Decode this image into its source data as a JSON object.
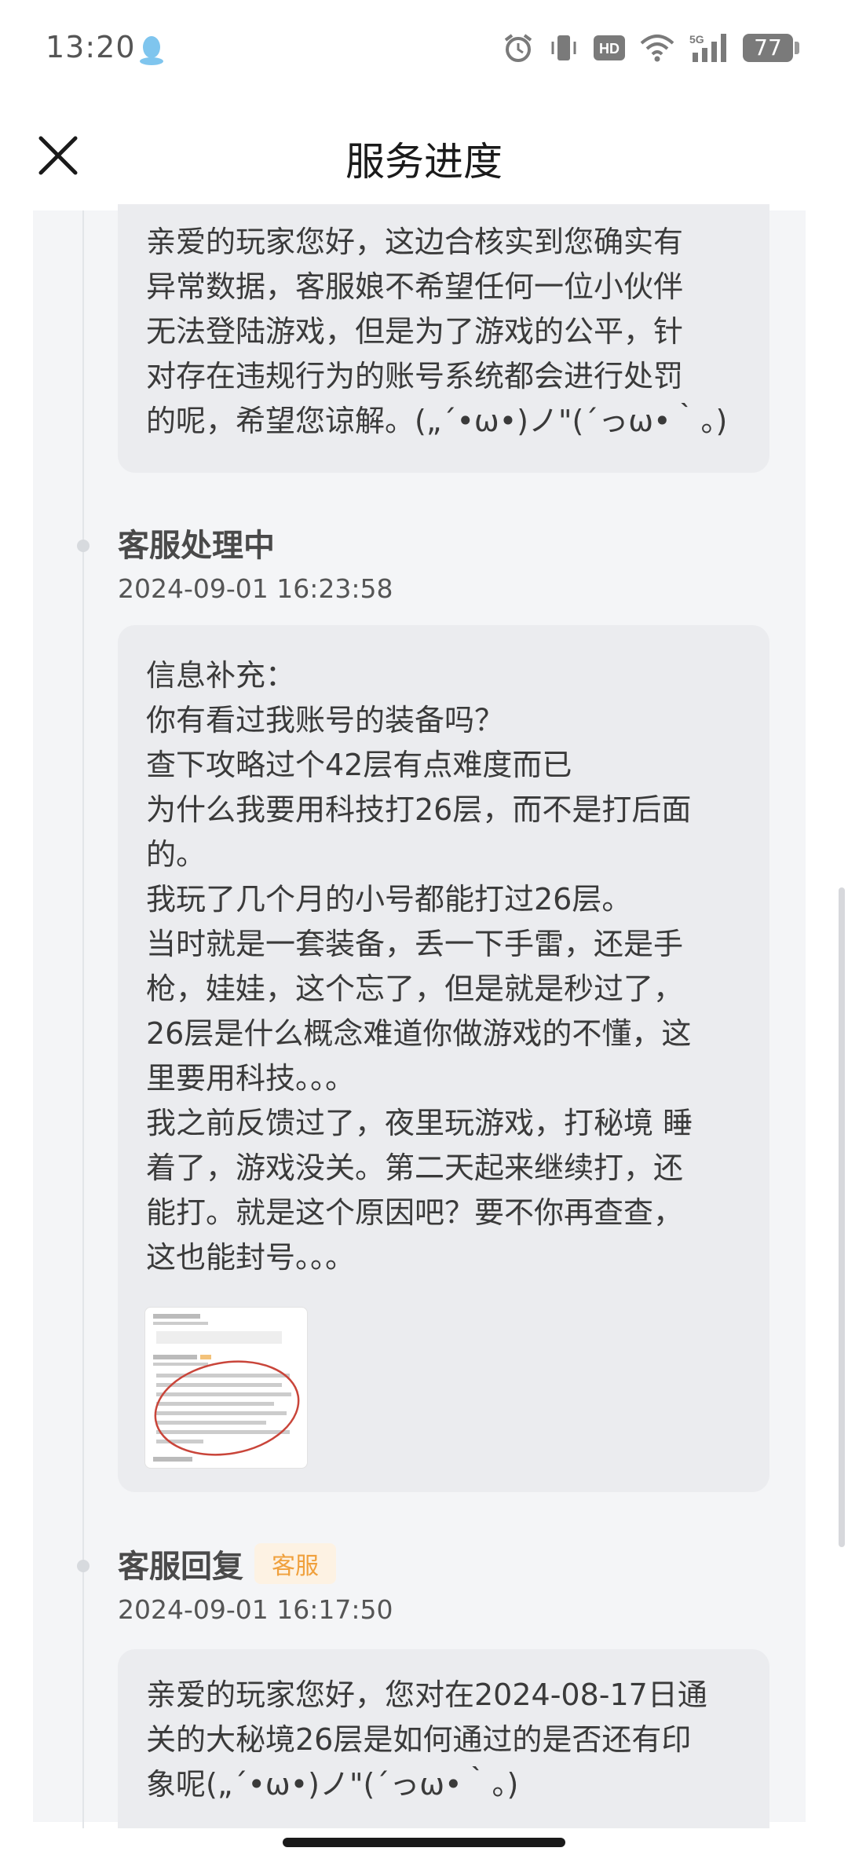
{
  "status_bar": {
    "time": "13:20",
    "icons": [
      "qq-icon",
      "alarm-icon",
      "vibrate-icon",
      "hd-icon",
      "wifi-icon",
      "5g-signal-icon"
    ],
    "battery": "77"
  },
  "header": {
    "title": "服务进度"
  },
  "entries": [
    {
      "message": "亲爱的玩家您好，这边合核实到您确实有\n异常数据，客服娘不希望任何一位小伙伴\n无法登陆游戏，但是为了游戏的公平，针\n对存在违规行为的账号系统都会进行处罚\n的呢，希望您谅解。(„´•ω•)ノ\"(´っω•｀。)"
    },
    {
      "title": "客服处理中",
      "time": "2024-09-01 16:23:58",
      "message": "信息补充：\n你有看过我账号的装备吗？\n查下攻略过个42层有点难度而已\n为什么我要用科技打26层，而不是打后面\n的。\n我玩了几个月的小号都能打过26层。\n当时就是一套装备，丢一下手雷，还是手\n枪，娃娃，这个忘了，但是就是秒过了，\n26层是什么概念难道你做游戏的不懂，这\n里要用科技。。。\n我之前反馈过了，夜里玩游戏，打秘境 睡\n着了，游戏没关。第二天起来继续打，还\n能打。就是这个原因吧？要不你再查查，\n这也能封号。。。"
    },
    {
      "title": "客服回复",
      "tag": "客服",
      "time": "2024-09-01 16:17:50",
      "message": "亲爱的玩家您好，您对在2024-08-17日通\n关的大秘境26层是如何通过的是否还有印\n象呢(„´•ω•)ノ\"(´っω•｀。)"
    }
  ],
  "colors": {
    "page_bg": "#f4f5f7",
    "card_bg": "#ebecef",
    "tag_text": "#f0a03c",
    "tag_bg": "#fdf2e3"
  }
}
